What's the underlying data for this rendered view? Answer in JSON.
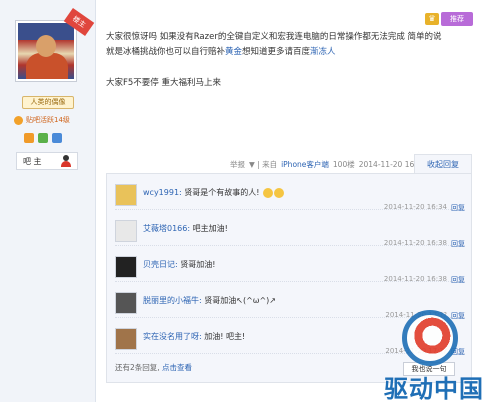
{
  "sidebar": {
    "louzhu_badge": "楼主",
    "title_badge": "人类的偶像",
    "level_text": "贴吧活跃14级",
    "bar_name": "吧 主"
  },
  "header": {
    "medal_icon": "crown-icon",
    "tuijian_label": "推荐"
  },
  "post": {
    "line1_pre": "大家很惊讶吗 如果没有Razer的全键自定义和宏我连电脑的日常操作都无法完成 简单的说就是冰桶挑战你也可以自行赔补",
    "line1_link1": "黄金",
    "line1_mid": "想知道更多请百度",
    "line1_link2": "渐冻人",
    "line2": "大家F5不要停 重大福利马上来"
  },
  "meta": {
    "report": "举报",
    "separator": "▼ | 来自",
    "client": "iPhone客户端",
    "floor": "100楼",
    "datetime": "2014-11-20 16:29",
    "collapse_reply": "收起回复"
  },
  "replies": [
    {
      "user": "wcy1991:",
      "text": "贤哥是个有故事的人!",
      "time": "2014-11-20 16:34",
      "reply_label": "回复",
      "emoji": true
    },
    {
      "user": "艾薇塔0166:",
      "text": "吧主加油!",
      "time": "2014-11-20 16:38",
      "reply_label": "回复",
      "emoji": false
    },
    {
      "user": "贝壳日记:",
      "text": "贤哥加油!",
      "time": "2014-11-20 16:38",
      "reply_label": "回复",
      "emoji": false
    },
    {
      "user": "脱丽里的小福牛:",
      "text": "贤哥加油↖(^ω^)↗",
      "time": "2014-11-20 17:??",
      "reply_label": "回复",
      "emoji": false
    },
    {
      "user": "实在没名用了呀:",
      "text": "加油! 吧主!",
      "time": "2014-11-20 17:??",
      "reply_label": "回复",
      "emoji": false
    }
  ],
  "replies_footer": {
    "count_text": "还有2条回复,",
    "more_link": "点击查看",
    "my_say": "我也说一句"
  },
  "watermark": {
    "text": "驱动中国"
  }
}
